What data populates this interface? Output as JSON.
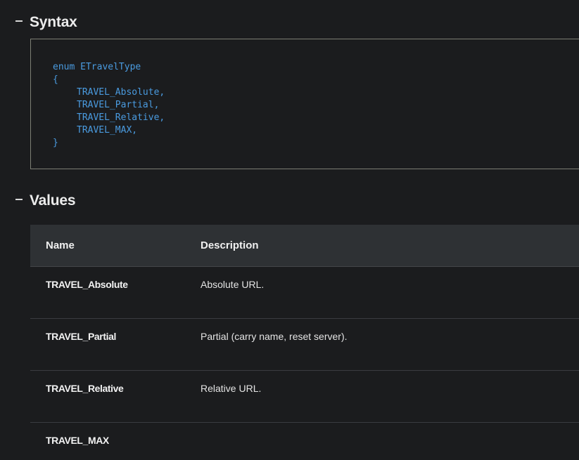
{
  "sections": {
    "syntax": {
      "title": "Syntax"
    },
    "values": {
      "title": "Values"
    }
  },
  "code": {
    "lines": [
      "enum ETravelType",
      "{",
      "TRAVEL_Absolute,",
      "TRAVEL_Partial,",
      "TRAVEL_Relative,",
      "TRAVEL_MAX,",
      "}"
    ]
  },
  "table": {
    "headers": {
      "name": "Name",
      "description": "Description"
    },
    "rows": [
      {
        "name": "TRAVEL_Absolute",
        "description": "Absolute URL."
      },
      {
        "name": "TRAVEL_Partial",
        "description": "Partial (carry name, reset server)."
      },
      {
        "name": "TRAVEL_Relative",
        "description": "Relative URL."
      },
      {
        "name": "TRAVEL_MAX",
        "description": ""
      }
    ]
  },
  "colors": {
    "background": "#1b1c1e",
    "code_text": "#4a9be0",
    "table_header_bg": "#2e3134",
    "code_border": "#7d7f74"
  }
}
